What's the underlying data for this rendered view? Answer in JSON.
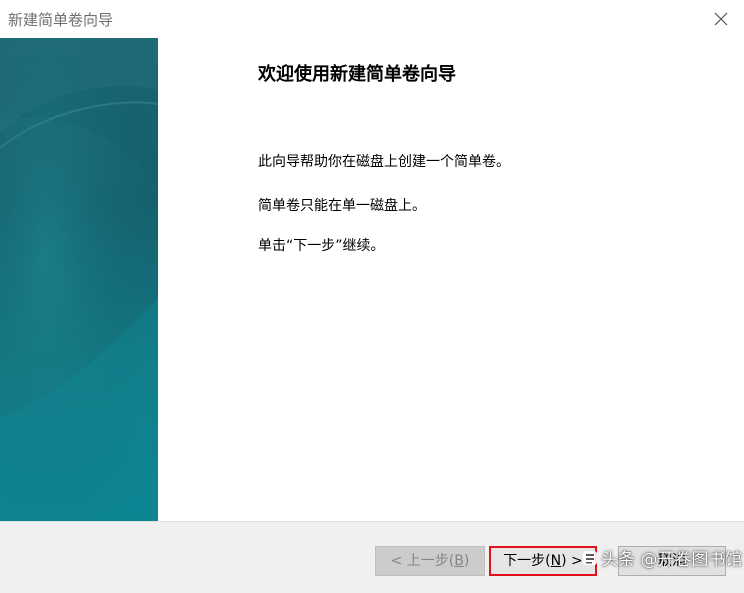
{
  "window": {
    "title": "新建简单卷向导",
    "close_icon": "close-icon"
  },
  "content": {
    "heading": "欢迎使用新建简单卷向导",
    "paragraphs": [
      "此向导帮助你在磁盘上创建一个简单卷。",
      "简单卷只能在单一磁盘上。",
      "单击“下一步”继续。"
    ]
  },
  "footer": {
    "back": {
      "prefix": "< 上一步(",
      "key": "B",
      "suffix": ")"
    },
    "next": {
      "prefix": "下一步(",
      "key": "N",
      "suffix": ") >"
    },
    "cancel": "取消"
  },
  "watermark": {
    "text": "头条 @开卷图书馆",
    "icon": "watermark-logo-icon"
  },
  "colors": {
    "banner_dark": "#13606d",
    "banner_light": "#0d8390",
    "highlight_border": "#e0121b",
    "footer_bg": "#f0f0f0"
  }
}
